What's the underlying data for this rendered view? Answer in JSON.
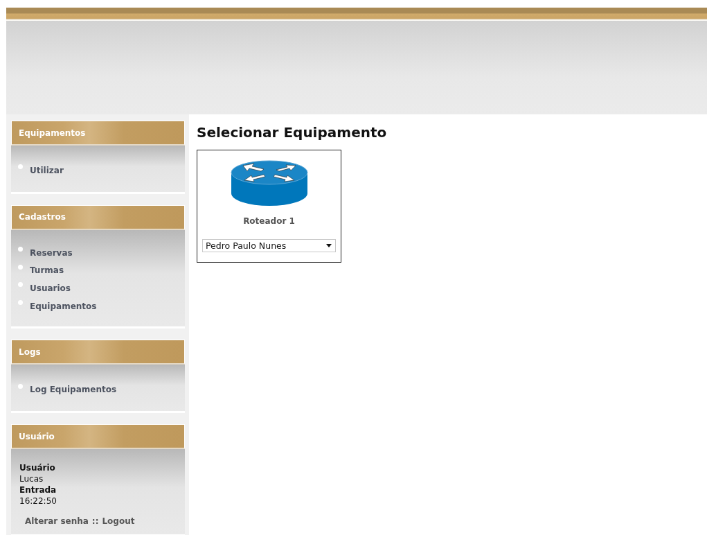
{
  "sidebar": {
    "sections": [
      {
        "title": "Equipamentos",
        "kind": "menu",
        "items": [
          {
            "label": "Utilizar"
          }
        ]
      },
      {
        "title": "Cadastros",
        "kind": "menu",
        "items": [
          {
            "label": "Reservas"
          },
          {
            "label": "Turmas"
          },
          {
            "label": "Usuarios"
          },
          {
            "label": "Equipamentos"
          }
        ]
      },
      {
        "title": "Logs",
        "kind": "menu",
        "items": [
          {
            "label": "Log Equipamentos"
          }
        ]
      },
      {
        "title": "Usuário",
        "kind": "user",
        "fields": [
          {
            "label": "Usuário",
            "value": "Lucas"
          },
          {
            "label": "Entrada",
            "value": "16:22:50"
          }
        ],
        "links": [
          "Alterar senha",
          "Logout"
        ],
        "separator": "::"
      }
    ]
  },
  "main": {
    "title": "Selecionar Equipamento",
    "equipment": [
      {
        "name": "Roteador 1",
        "user": "Pedro Paulo Nunes"
      }
    ]
  }
}
